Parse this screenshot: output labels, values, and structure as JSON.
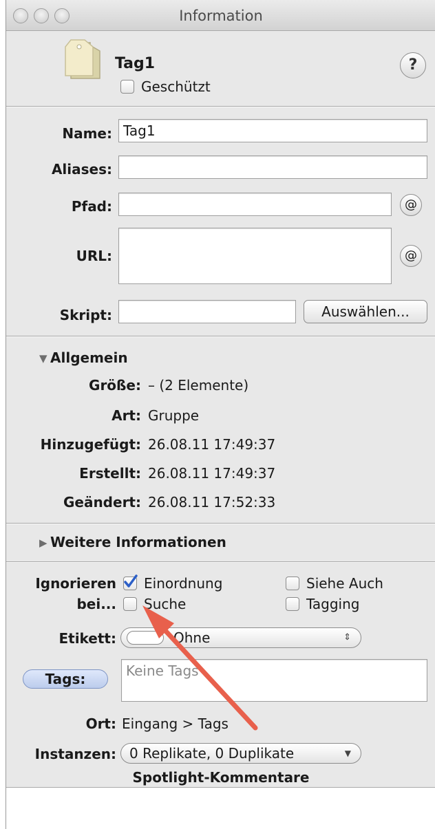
{
  "window": {
    "title": "Information"
  },
  "header": {
    "name": "Tag1",
    "protected_label": "Geschützt",
    "help": "?"
  },
  "fields": {
    "name_label": "Name:",
    "name_value": "Tag1",
    "aliases_label": "Aliases:",
    "path_label": "Pfad:",
    "url_label": "URL:",
    "script_label": "Skript:",
    "choose_button": "Auswählen...",
    "at_symbol": "@"
  },
  "general": {
    "title": "Allgemein",
    "rows": [
      {
        "label": "Größe:",
        "value": "– (2 Elemente)"
      },
      {
        "label": "Art:",
        "value": "Gruppe"
      },
      {
        "label": "Hinzugefügt:",
        "value": "26.08.11 17:49:37"
      },
      {
        "label": "Erstellt:",
        "value": "26.08.11 17:49:37"
      },
      {
        "label": "Geändert:",
        "value": "26.08.11 17:52:33"
      }
    ]
  },
  "more_info": {
    "title": "Weitere Informationen"
  },
  "ignore": {
    "label_line1": "Ignorieren",
    "label_line2": "bei...",
    "options": [
      {
        "label": "Einordnung",
        "checked": true
      },
      {
        "label": "Siehe Auch",
        "checked": false
      },
      {
        "label": "Suche",
        "checked": false
      },
      {
        "label": "Tagging",
        "checked": false
      }
    ]
  },
  "label": {
    "label": "Etikett:",
    "value": "Ohne"
  },
  "tags": {
    "label": "Tags:",
    "placeholder": "Keine Tags"
  },
  "location": {
    "label": "Ort:",
    "value": "Eingang > Tags"
  },
  "instances": {
    "label": "Instanzen:",
    "value": "0 Replikate, 0 Duplikate"
  },
  "spotlight": {
    "title": "Spotlight-Kommentare"
  },
  "colors": {
    "accent": "#3b6fd6",
    "annotation_arrow": "#e8604c"
  }
}
